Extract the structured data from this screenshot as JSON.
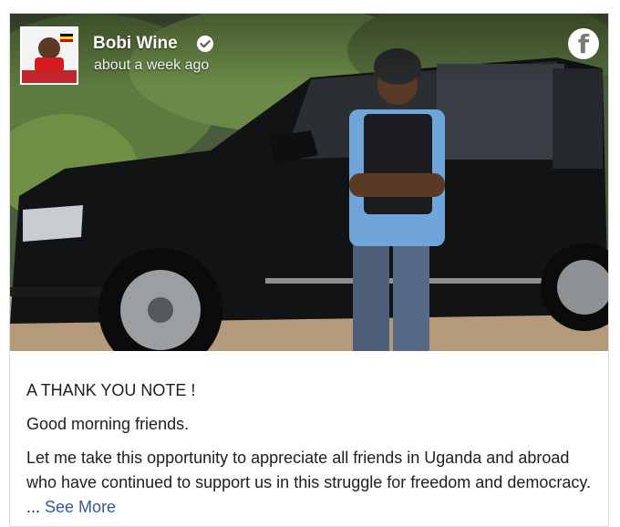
{
  "post": {
    "author": {
      "name": "Bobi Wine",
      "verified": true,
      "timestamp": "about a week ago"
    },
    "platform_icon": "facebook-icon",
    "image_alt_subject": "man in helmet and vest standing in front of black SUV",
    "text": {
      "heading": "A THANK YOU NOTE !",
      "greeting": "Good morning friends.",
      "body": "Let me take this opportunity to appreciate all friends in Uganda and abroad who have continued to support us in this struggle for freedom and democracy. ...",
      "see_more": "See More"
    }
  },
  "colors": {
    "link": "#385898",
    "text": "#1c1e21",
    "verified_badge": "#ffffff"
  }
}
